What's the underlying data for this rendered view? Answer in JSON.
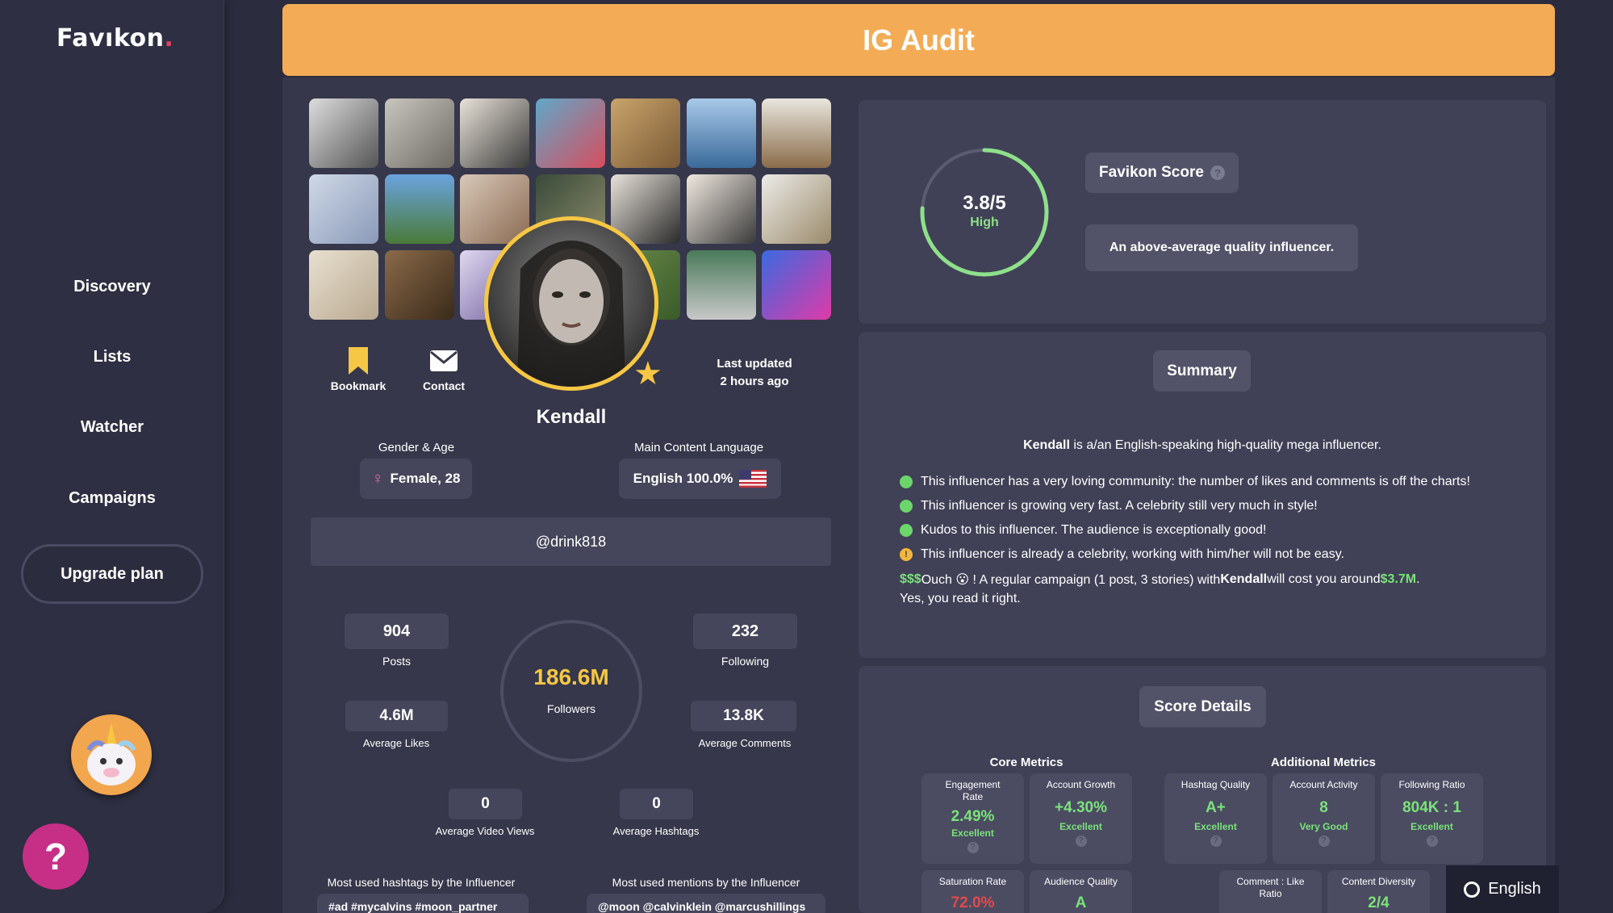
{
  "sidebar": {
    "logo": "Favıkon",
    "logo_dot": ".",
    "items": [
      {
        "label": "Discovery"
      },
      {
        "label": "Lists"
      },
      {
        "label": "Watcher"
      },
      {
        "label": "Campaigns"
      }
    ],
    "upgrade_label": "Upgrade plan",
    "help_label": "?"
  },
  "header": {
    "title": "IG Audit"
  },
  "profile": {
    "bookmark_label": "Bookmark",
    "contact_label": "Contact",
    "last_updated_line1": "Last updated",
    "last_updated_line2": "2 hours ago",
    "name": "Kendall",
    "gender_age_label": "Gender & Age",
    "gender_age_value": "Female, 28",
    "language_label": "Main Content Language",
    "language_value": "English 100.0%",
    "handle": "@drink818"
  },
  "stats": {
    "posts": {
      "value": "904",
      "label": "Posts"
    },
    "following": {
      "value": "232",
      "label": "Following"
    },
    "followers": {
      "value": "186.6M",
      "label": "Followers"
    },
    "avg_likes": {
      "value": "4.6M",
      "label": "Average Likes"
    },
    "avg_comments": {
      "value": "13.8K",
      "label": "Average Comments"
    },
    "avg_video_views": {
      "value": "0",
      "label": "Average Video Views"
    },
    "avg_hashtags": {
      "value": "0",
      "label": "Average Hashtags"
    },
    "hashtags_label": "Most used hashtags by the Influencer",
    "hashtags_value": "#ad #mycalvins #moon_partner",
    "mentions_label": "Most used mentions by the Influencer",
    "mentions_value": "@moon @calvinklein @marcushillings"
  },
  "score": {
    "value": "3.8/5",
    "level": "High",
    "fraction": 0.76,
    "title": "Favikon Score",
    "description": "An above-average quality influencer."
  },
  "summary": {
    "title": "Summary",
    "intro_name": "Kendall",
    "intro_rest": " is a/an English-speaking high-quality mega influencer.",
    "points": [
      "This influencer has a very loving community: the number of likes and comments is off the charts!",
      "This influencer is growing very fast. A celebrity still very much in style!",
      "Kudos to this influencer. The audience is exceptionally good!"
    ],
    "warning": "This influencer is already a celebrity, working with him/her will not be easy.",
    "cost_prefix": "$$$",
    "cost_text_1": " Ouch 😮 ! A regular campaign (1 post, 3 stories) with ",
    "cost_name": "Kendall",
    "cost_text_2": " will cost you around ",
    "cost_value": "$3.7M",
    "cost_end": ".",
    "cost_line2": "Yes, you read it right."
  },
  "score_details": {
    "title": "Score Details",
    "core_title": "Core Metrics",
    "additional_title": "Additional Metrics",
    "cards": [
      {
        "title": "Engagement Rate",
        "value": "2.49%",
        "level": "Excellent"
      },
      {
        "title": "Account Growth",
        "value": "+4.30%",
        "level": "Excellent"
      },
      {
        "title": "Hashtag Quality",
        "value": "A+",
        "level": "Excellent"
      },
      {
        "title": "Account Activity",
        "value": "8",
        "level": "Very Good"
      },
      {
        "title": "Following Ratio",
        "value": "804K : 1",
        "level": "Excellent"
      }
    ],
    "row2": [
      {
        "title": "Saturation Rate",
        "value": "72.0%"
      },
      {
        "title": "Audience Quality",
        "value": "A"
      },
      {
        "title": "Comment : Like Ratio",
        "value": ""
      },
      {
        "title": "Content Diversity",
        "value": "2/4"
      }
    ]
  },
  "language_switch": {
    "label": "English"
  },
  "colors": {
    "accent": "#f3ac55",
    "green": "#7be27a",
    "gold": "#f6c744",
    "pink": "#c72f86"
  }
}
